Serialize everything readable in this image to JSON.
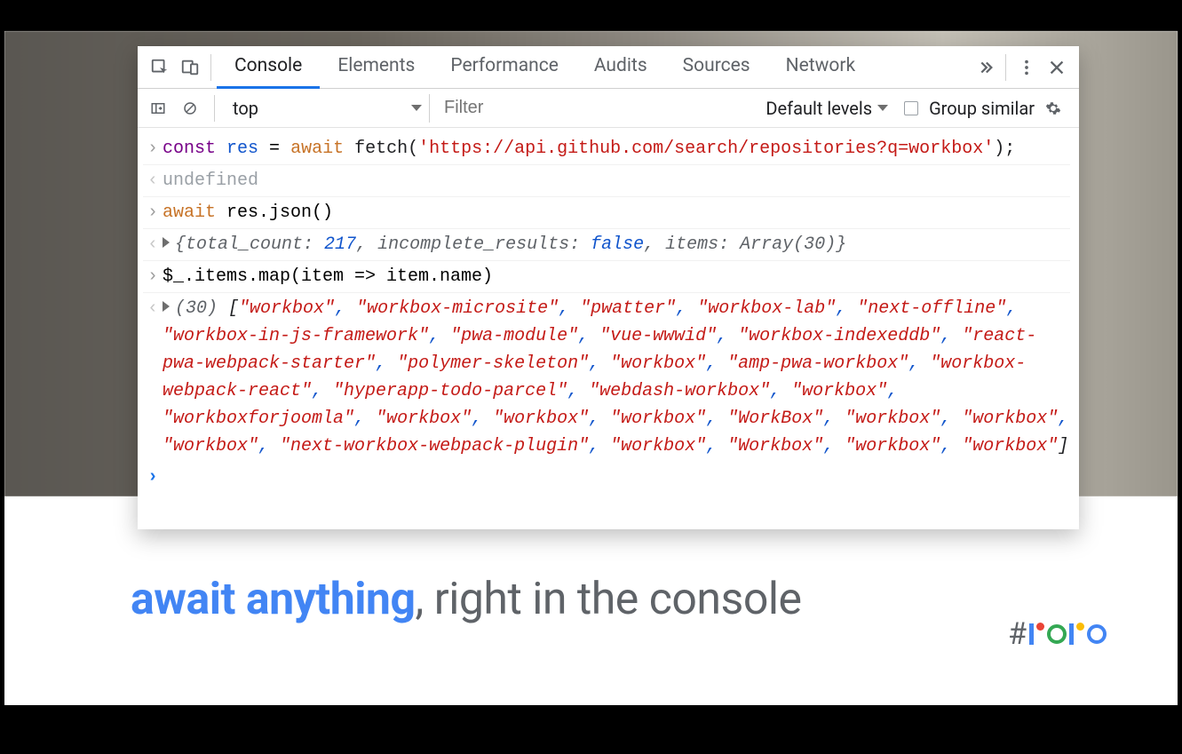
{
  "toolbar": {
    "tabs": [
      "Console",
      "Elements",
      "Performance",
      "Audits",
      "Sources",
      "Network"
    ],
    "active_tab": "Console"
  },
  "subbar": {
    "context": "top",
    "filter_placeholder": "Filter",
    "levels_label": "Default levels",
    "group_similar_label": "Group similar"
  },
  "console": {
    "line1": {
      "kw": "const",
      "var": "res",
      "eq": " = ",
      "aw": "await",
      "fn": " fetch(",
      "str": "'https://api.github.com/search/repositories?q=workbox'",
      "end": ");"
    },
    "line2": "undefined",
    "line3": {
      "aw": "await",
      "rest": " res.json()"
    },
    "line4": {
      "open": "{",
      "k1": "total_count:",
      "v1": " 217",
      "c1": ", ",
      "k2": "incomplete_results:",
      "v2": " false",
      "c2": ", ",
      "k3": "items:",
      "v3": " Array(30)",
      "close": "}"
    },
    "line5": "$_.items.map(item => item.name)",
    "array_prefix": "(30) ",
    "array_items": [
      "workbox",
      "workbox-microsite",
      "pwatter",
      "workbox-lab",
      "next-offline",
      "workbox-in-js-framework",
      "pwa-module",
      "vue-wwwid",
      "workbox-indexeddb",
      "react-pwa-webpack-starter",
      "polymer-skeleton",
      "workbox",
      "amp-pwa-workbox",
      "workbox-webpack-react",
      "hyperapp-todo-parcel",
      "webdash-workbox",
      "workbox",
      "workboxforjoomla",
      "workbox",
      "workbox",
      "workbox",
      "WorkBox",
      "workbox",
      "workbox",
      "workbox",
      "next-workbox-webpack-plugin",
      "workbox",
      "Workbox",
      "workbox",
      "workbox"
    ]
  },
  "caption": {
    "bold": "await anything",
    "rest": ", right in the console"
  },
  "logo_hash": "#",
  "chart_data": null
}
